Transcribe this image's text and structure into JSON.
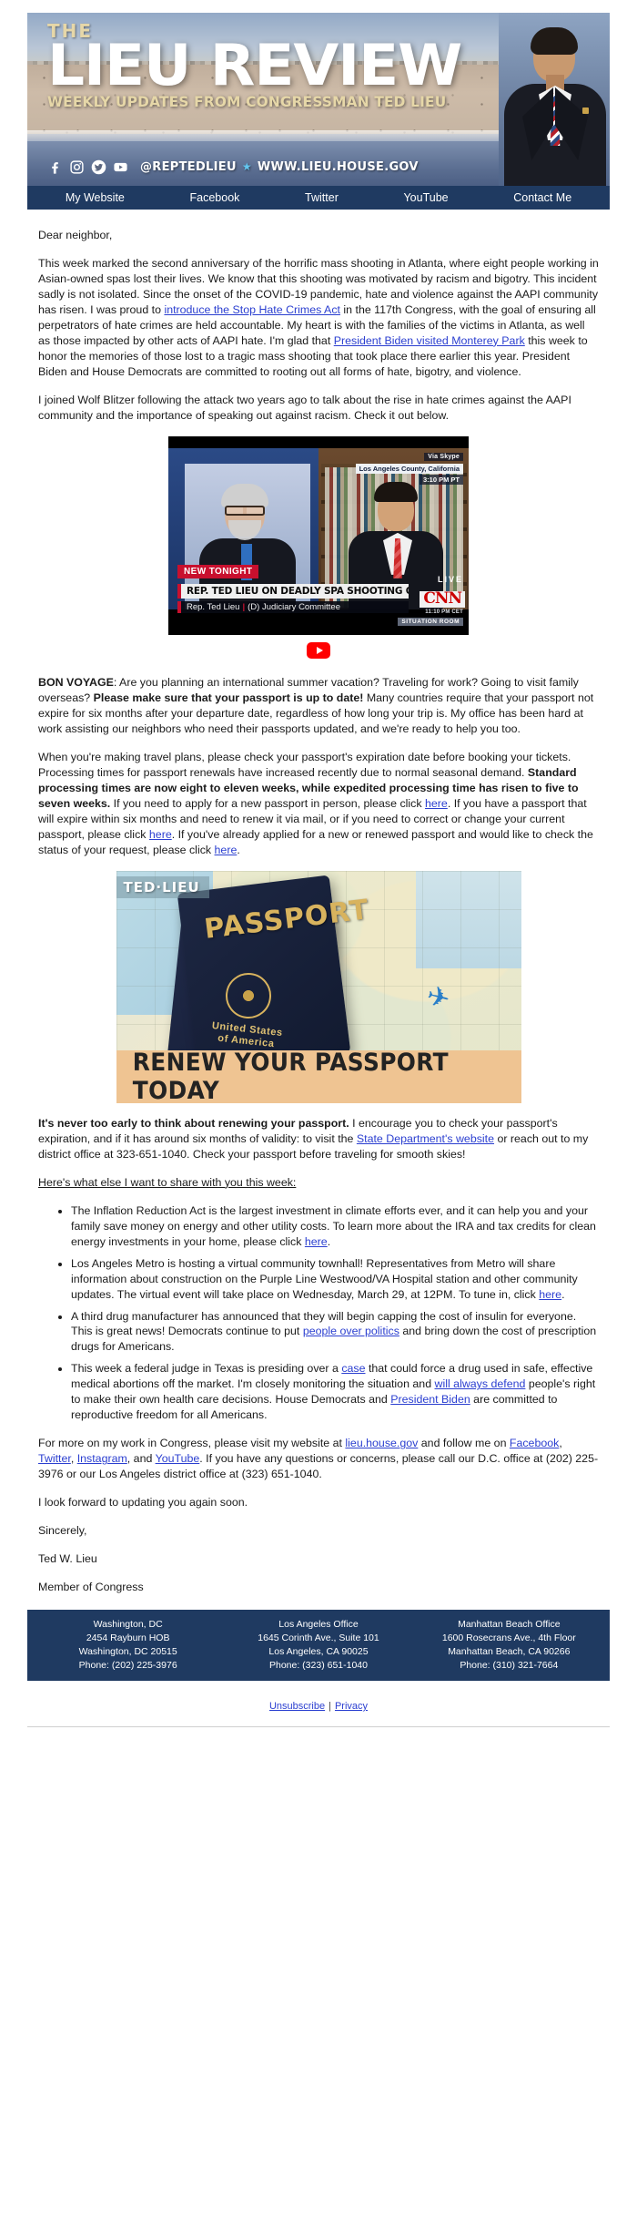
{
  "header": {
    "the": "THE",
    "title": "LIEU REVIEW",
    "subtitle": "WEEKLY UPDATES FROM CONGRESSMAN TED LIEU",
    "handle": "@REPTEDLIEU",
    "star": "★",
    "website": "WWW.LIEU.HOUSE.GOV",
    "social_icons": [
      "facebook-icon",
      "instagram-icon",
      "twitter-icon",
      "youtube-icon"
    ]
  },
  "nav": {
    "items": [
      {
        "label": "My Website"
      },
      {
        "label": "Facebook"
      },
      {
        "label": "Twitter"
      },
      {
        "label": "YouTube"
      },
      {
        "label": "Contact Me"
      }
    ]
  },
  "body": {
    "salutation": "Dear neighbor,",
    "p1_a": "This week marked the second anniversary of the horrific mass shooting in Atlanta, where eight people working in Asian-owned spas lost their lives. We know that this shooting was motivated by racism and bigotry. This incident sadly is not isolated. Since the onset of the COVID-19 pandemic, hate and violence against the AAPI community has risen. I was proud to ",
    "p1_link1": "introduce the Stop Hate Crimes Act",
    "p1_b": " in the 117th Congress, with the goal of ensuring all perpetrators of hate crimes are held accountable. My heart is with the families of the victims in Atlanta, as well as those impacted by other acts of AAPI hate. I'm glad that ",
    "p1_link2": "President Biden visited Monterey Park",
    "p1_c": " this week to honor the memories of those lost to a tragic mass shooting that took place there earlier this year. President Biden and House Democrats are committed to rooting out all forms of hate, bigotry, and violence.",
    "p2": "I joined Wolf Blitzer following the attack two years ago to talk about the rise in hate crimes against the AAPI community and the importance of speaking out against racism. Check it out below.",
    "bon_voyage_label": "BON VOYAGE",
    "p3_a": ": Are you planning an international summer vacation? Traveling for work? Going to visit family overseas? ",
    "p3_bold": "Please make sure that your passport is up to date!",
    "p3_b": " Many countries require that your passport not expire for six months after your departure date, regardless of how long your trip is. My office has been hard at work assisting our neighbors who need their passports updated, and we're ready to help you too.",
    "p4_a": "When you're making travel plans, please check your passport's expiration date before booking your tickets. Processing times for passport renewals have increased recently due to normal seasonal demand. ",
    "p4_bold": "Standard processing times are now eight to eleven weeks, while expedited processing time has risen to five to seven weeks.",
    "p4_b": " If you need to apply for a new passport in person, please click ",
    "p4_here1": "here",
    "p4_c": ". If you have a passport that will expire within six months and need to renew it via mail, or if you need to correct or change your current passport, please click ",
    "p4_here2": "here",
    "p4_d": ". If you've already applied for a new or renewed passport and would like to check the status of your request, please click ",
    "p4_here3": "here",
    "p4_e": ".",
    "p5_bold": "It's never too early to think about renewing your passport.",
    "p5_a": " I encourage you to check your passport's expiration, and if it has around six months of validity: to visit the ",
    "p5_link": "State Department's website",
    "p5_b": " or reach out to my district office at 323-651-1040. Check your passport before traveling for smooth skies!",
    "share_heading": "Here's what else I want to share with you this week:",
    "closing_a": "For more on my work in Congress, please visit my website at ",
    "closing_site": "lieu.house.gov",
    "closing_b": " and follow me on ",
    "closing_fb": "Facebook",
    "closing_tw": "Twitter",
    "closing_ig": "Instagram",
    "closing_yt": "YouTube",
    "closing_c": ". If you have any questions or concerns, please call our D.C. office at (202) 225-3976 or our Los Angeles district office at (323) 651-1040.",
    "closing_look": "I look forward to updating you again soon.",
    "sincerely": "Sincerely,",
    "signature_name": "Ted W. Lieu",
    "signature_title": "Member of Congress"
  },
  "bullets": [
    {
      "a": "The Inflation Reduction Act is the largest investment in climate efforts ever, and it can help you and your family save money on energy and other utility costs. To learn more about the IRA and tax credits for clean energy investments in your home, please click ",
      "link": "here",
      "b": "."
    },
    {
      "a": "Los Angeles Metro is hosting a virtual community townhall! Representatives from Metro will share information about construction on the Purple Line Westwood/VA Hospital station and other community updates. The virtual event will take place on Wednesday, March 29, at 12PM. To tune in, click ",
      "link": "here",
      "b": "."
    },
    {
      "a": "A third drug manufacturer has announced that they will begin capping the cost of insulin for everyone. This is great news! Democrats continue to put ",
      "link": "people over politics",
      "b": " and bring down the cost of prescription drugs for Americans."
    },
    {
      "a": "This week a federal judge in Texas is presiding over a ",
      "link": "case",
      "b": " that could force a drug used in safe, effective medical abortions off the market. I'm closely monitoring the situation and ",
      "link2": "will always defend",
      "c": " people's right to make their own health care decisions. House Democrats and ",
      "link3": "President Biden",
      "d": " are committed to reproductive freedom for all Americans."
    }
  ],
  "video": {
    "via_skype": "Via Skype",
    "location": "Los Angeles County, California",
    "time": "3:10 PM PT",
    "new_tonight": "NEW TONIGHT",
    "headline": "REP. TED LIEU ON DEADLY SPA SHOOTING OF ASIAN WOMEN",
    "guest_name": "Rep. Ted Lieu",
    "guest_sep": "|",
    "guest_title": "(D) Judiciary Committee",
    "live": "LIVE",
    "network": "CNN",
    "cet_time": "11:10 PM CET",
    "show": "SITUATION ROOM",
    "play_button": "youtube-play-icon"
  },
  "passport": {
    "brand": "TED·LIEU",
    "passport_word": "PASSPORT",
    "united_states": "United States",
    "of_america": "of America",
    "banner": "RENEW YOUR PASSPORT TODAY",
    "plane_icon": "airplane-icon"
  },
  "footer": {
    "offices": [
      {
        "name": "Washington, DC",
        "line1": "2454 Rayburn HOB",
        "line2": "Washington, DC 20515",
        "phone": "Phone: (202) 225-3976"
      },
      {
        "name": "Los Angeles Office",
        "line1": "1645 Corinth Ave., Suite 101",
        "line2": "Los Angeles, CA 90025",
        "phone": "Phone: (323) 651-1040"
      },
      {
        "name": "Manhattan Beach Office",
        "line1": "1600 Rosecrans Ave., 4th Floor",
        "line2": "Manhattan Beach, CA 90266",
        "phone": "Phone: (310) 321-7664"
      }
    ],
    "unsubscribe": "Unsubscribe",
    "separator": "|",
    "privacy": "Privacy"
  },
  "colors": {
    "navy": "#1f3a61",
    "link": "#2b3fd0",
    "gold": "#e6d7a8",
    "cnn_red": "#c8102e",
    "banner_tan": "#efc492"
  }
}
